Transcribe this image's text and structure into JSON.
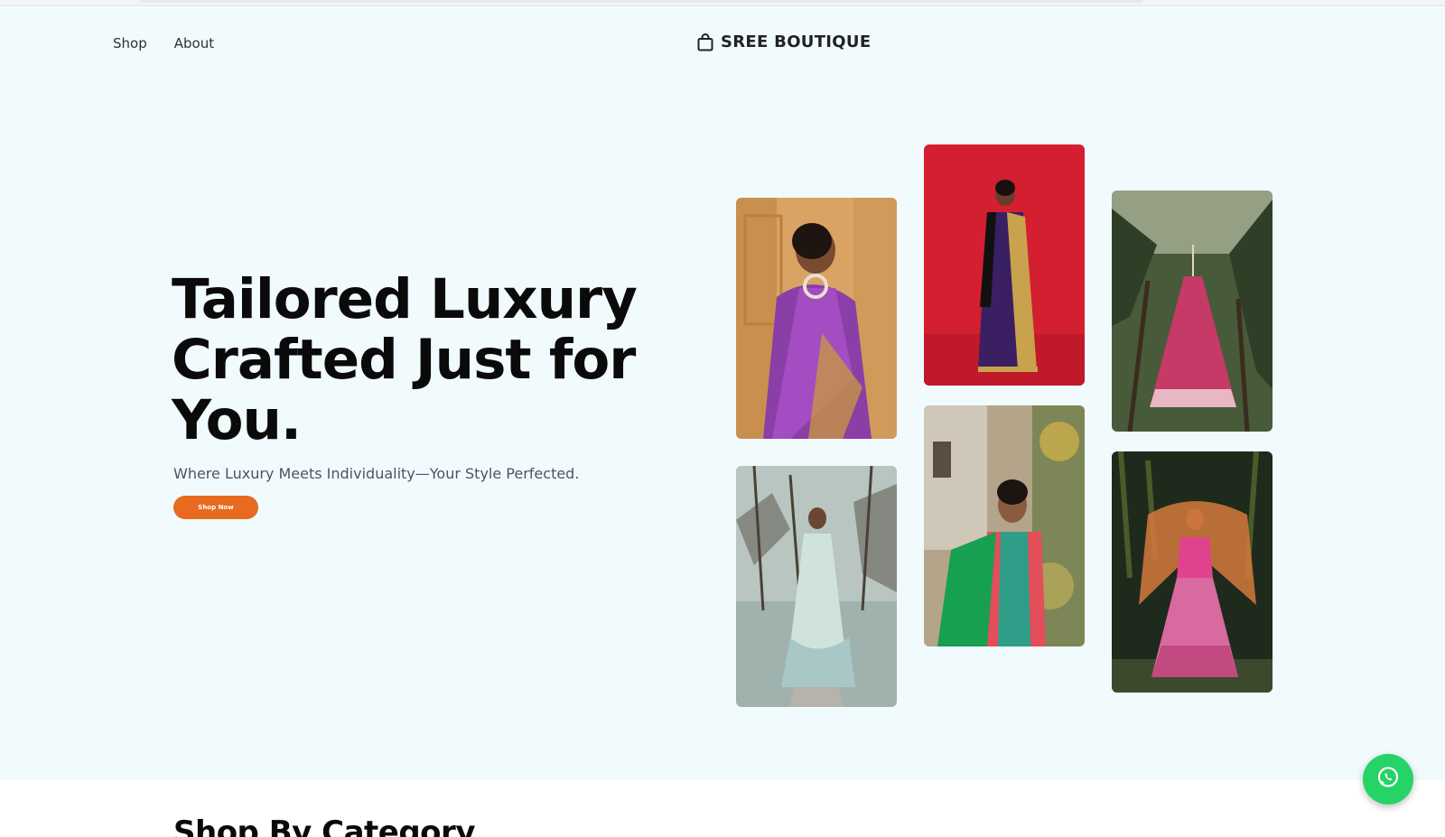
{
  "nav": {
    "items": [
      {
        "label": "Shop"
      },
      {
        "label": "About"
      }
    ]
  },
  "brand": {
    "name": "SREE BOUTIQUE",
    "icon": "shopping-bag-icon"
  },
  "hero": {
    "headline": "Tailored Luxury Crafted Just for You.",
    "subtitle": "Where Luxury Meets Individuality—Your Style Perfected.",
    "cta_label": "Shop Now"
  },
  "gallery": {
    "photos": [
      {
        "name": "purple-silk-saree-photo"
      },
      {
        "name": "red-backdrop-saree-photo"
      },
      {
        "name": "pink-lehenga-hanging-photo"
      },
      {
        "name": "mint-gown-street-photo"
      },
      {
        "name": "green-dupatta-kurta-photo"
      },
      {
        "name": "pink-bridal-lehenga-photo"
      }
    ]
  },
  "categories": {
    "title": "Shop By Category"
  },
  "whatsapp": {
    "icon": "whatsapp-icon"
  },
  "colors": {
    "hero_bg": "#f1fbfd",
    "accent": "#e86a1f",
    "whatsapp": "#25d366"
  }
}
